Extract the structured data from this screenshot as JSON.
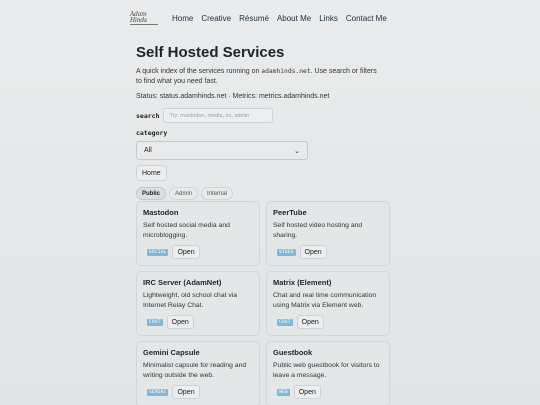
{
  "nav": {
    "logo": "Adam Hinds",
    "links": [
      "Home",
      "Creative",
      "Résumé",
      "About Me",
      "Links",
      "Contact Me"
    ]
  },
  "page": {
    "title": "Self Hosted Services",
    "desc_pre": "A quick index of the services running on ",
    "desc_domain": "adamhinds.net",
    "desc_post": ". Use search or filters to find what you need fast.",
    "status": "Status: status.adamhinds.net · Metrics: metrics.adamhinds.net"
  },
  "search": {
    "label": "search",
    "placeholder": "Try: mastodon, media, irc, admin"
  },
  "category": {
    "label": "category",
    "selected": "All"
  },
  "home_button": "Home",
  "filters": [
    "Public",
    "Admin",
    "Internal"
  ],
  "cards": [
    {
      "title": "Mastodon",
      "desc": "Self hosted social media and microblogging.",
      "tag": "SOCIAL",
      "action": "Open"
    },
    {
      "title": "PeerTube",
      "desc": "Self hosted video hosting and sharing.",
      "tag": "VIDEO",
      "action": "Open"
    },
    {
      "title": "IRC Server (AdamNet)",
      "desc": "Lightweight, old school chat via Internet Relay Chat.",
      "tag": "CHAT",
      "action": "Open"
    },
    {
      "title": "Matrix (Element)",
      "desc": "Chat and real time communication using Matrix via Element web.",
      "tag": "CHAT",
      "action": "Open"
    },
    {
      "title": "Gemini Capsule",
      "desc": "Minimalist capsule for reading and writing outside the web.",
      "tag": "GEMINI",
      "action": "Open"
    },
    {
      "title": "Guestbook",
      "desc": "Public web guestbook for visitors to leave a message.",
      "tag": "WEB",
      "action": "Open"
    }
  ]
}
